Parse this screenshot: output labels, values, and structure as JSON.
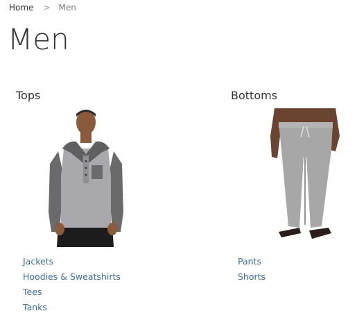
{
  "breadcrumb": {
    "home": "Home",
    "separator": ">",
    "current": "Men"
  },
  "page_title": "Men",
  "categories": [
    {
      "title": "Tops",
      "image_icon": "hooded-shirt-model-image",
      "links": [
        "Jackets",
        "Hoodies & Sweatshirts",
        "Tees",
        "Tanks"
      ]
    },
    {
      "title": "Bottoms",
      "image_icon": "pants-model-image",
      "links": [
        "Pants",
        "Shorts"
      ]
    }
  ],
  "colors": {
    "link": "#3b6da6",
    "text": "#333333",
    "muted": "#777777"
  }
}
